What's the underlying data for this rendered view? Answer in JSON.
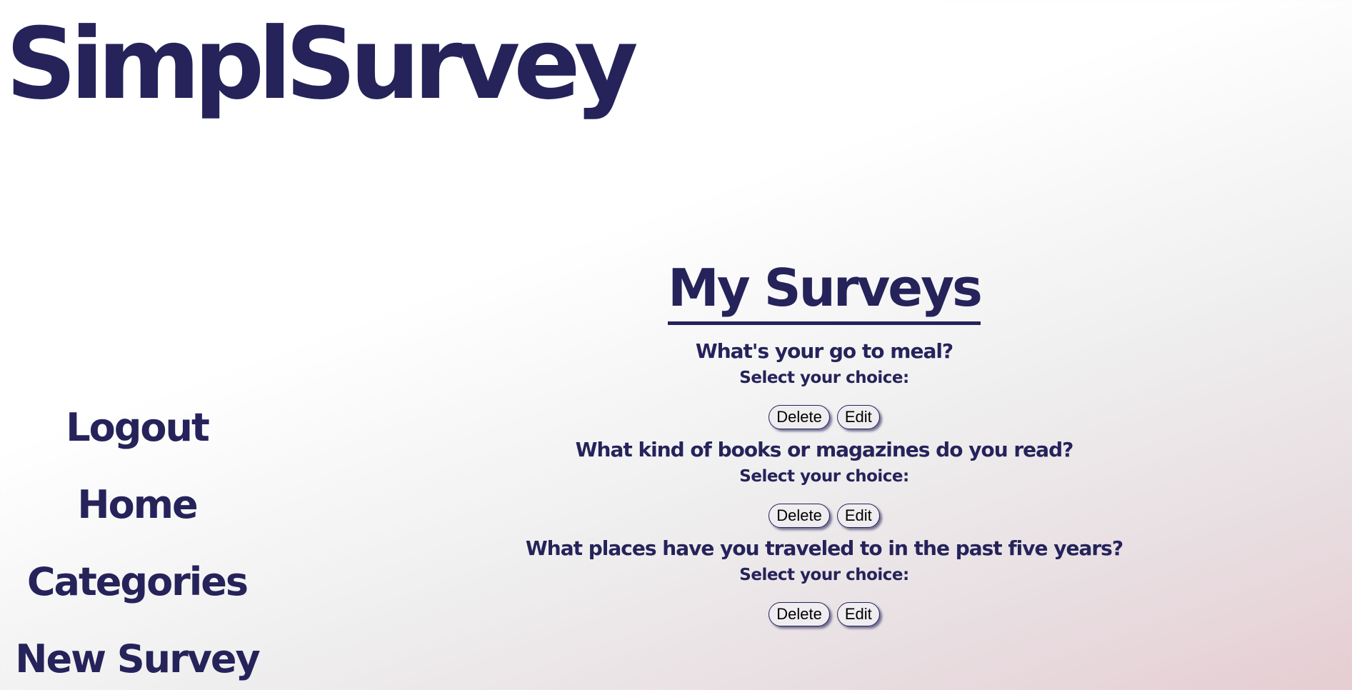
{
  "brand": {
    "title": "SimplSurvey"
  },
  "sidebar": {
    "items": [
      {
        "label": "Logout"
      },
      {
        "label": "Home"
      },
      {
        "label": "Categories"
      },
      {
        "label": "New Survey"
      }
    ]
  },
  "main": {
    "title": "My Surveys",
    "surveys": [
      {
        "question": "What's your go to meal?",
        "prompt": "Select your choice:",
        "delete_label": "Delete",
        "edit_label": "Edit"
      },
      {
        "question": "What kind of books or magazines do you read?",
        "prompt": "Select your choice:",
        "delete_label": "Delete",
        "edit_label": "Edit"
      },
      {
        "question": "What places have you traveled to in the past five years?",
        "prompt": "Select your choice:",
        "delete_label": "Delete",
        "edit_label": "Edit"
      }
    ]
  },
  "colors": {
    "primary": "#25235a",
    "button_bg": "#efedf0",
    "background_start": "#ffffff",
    "background_end": "#e6cdd2"
  }
}
